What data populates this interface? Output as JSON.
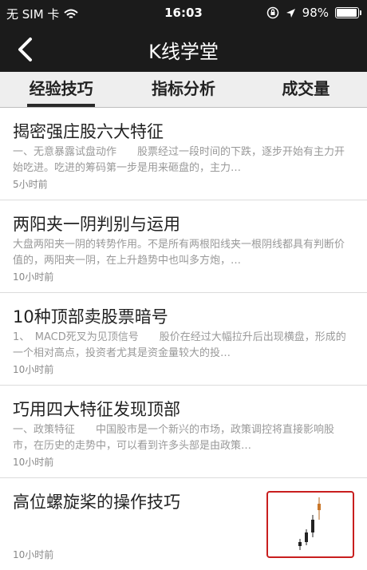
{
  "status": {
    "carrier": "无 SIM 卡",
    "time": "16:03",
    "battery": "98%",
    "battery_level": 0.98
  },
  "nav": {
    "title": "K线学堂"
  },
  "tabs": [
    "经验技巧",
    "指标分析",
    "成交量"
  ],
  "active_tab": 0,
  "articles": [
    {
      "title": "揭密强庄股六大特征",
      "summary": "一、无意暴露试盘动作　　股票经过一段时间的下跌，逐步开始有主力开始吃进。吃进的筹码第一步是用来砸盘的，主力…",
      "time": "5小时前"
    },
    {
      "title": "两阳夹一阴判别与运用",
      "summary": "大盘两阳夹一阴的转势作用。不是所有两根阳线夹一根阴线都具有判断价值的，两阳夹一阴，在上升趋势中也叫多方炮，…",
      "time": "10小时前"
    },
    {
      "title": "10种顶部卖股票暗号",
      "summary": "1、　MACD死叉为见顶信号　　股价在经过大幅拉升后出现横盘，形成的一个相对高点，投资者尤其是资金量较大的投…",
      "time": "10小时前"
    },
    {
      "title": "巧用四大特征发现顶部",
      "summary": "一、政策特征　　中国股市是一个新兴的市场，政策调控将直接影响股市，在历史的走势中，可以看到许多头部是由政策…",
      "time": "10小时前"
    },
    {
      "title": "高位螺旋桨的操作技巧",
      "summary": "",
      "time": "10小时前"
    }
  ]
}
